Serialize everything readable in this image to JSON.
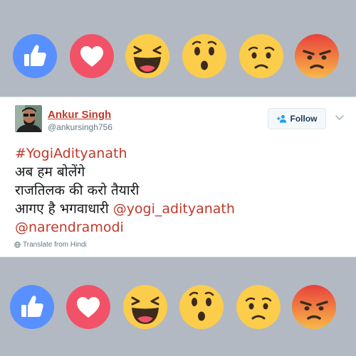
{
  "reactions": {
    "items": [
      {
        "name": "like",
        "icon": "thumbs-up-icon",
        "color": "#5890ff"
      },
      {
        "name": "love",
        "icon": "heart-icon",
        "color": "#f25268"
      },
      {
        "name": "haha",
        "icon": "laughing-face-icon",
        "color": "#fbcd4a"
      },
      {
        "name": "wow",
        "icon": "surprised-face-icon",
        "color": "#fbcd4a"
      },
      {
        "name": "sad",
        "icon": "sad-face-icon",
        "color": "#fbcd4a"
      },
      {
        "name": "angry",
        "icon": "angry-face-icon",
        "color": "#e24b3a"
      }
    ]
  },
  "tweet": {
    "author_name": "Ankur Singh",
    "author_handle": "@ankursingh756",
    "follow_label": "Follow",
    "hashtag": "#YogiAdityanath",
    "line1": "अब हम बोलेंगे",
    "line2": "राजतिलक की करो तैयारी",
    "line3": "आगए है भगवाधारी",
    "mention1": "@yogi_adityanath",
    "mention2": "@narendramodi",
    "translate_label": "Translate from Hindi"
  },
  "colors": {
    "link": "#c0392b",
    "background": "#b3b9c2"
  }
}
